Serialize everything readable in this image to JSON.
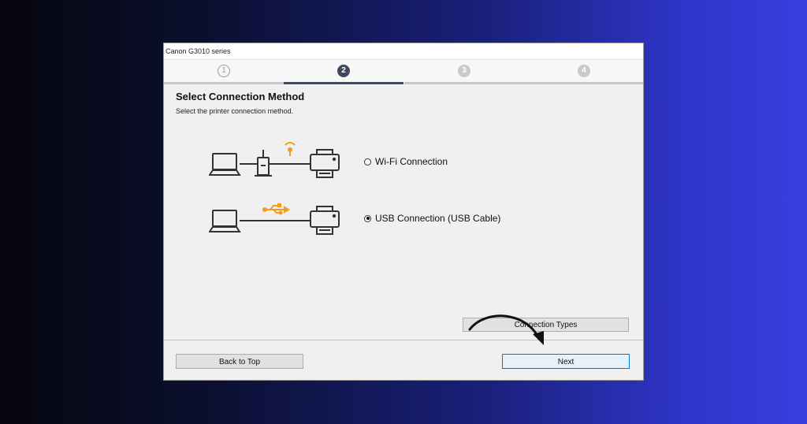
{
  "window": {
    "title": "Canon G3010 series"
  },
  "steps": [
    {
      "label": "1",
      "state": "done"
    },
    {
      "label": "2",
      "state": "active"
    },
    {
      "label": "3",
      "state": "inactive"
    },
    {
      "label": "4",
      "state": "inactive"
    }
  ],
  "main": {
    "heading": "Select Connection Method",
    "subheading": "Select the printer connection method."
  },
  "options": {
    "wifi": {
      "label": "Wi-Fi Connection",
      "selected": false,
      "icon": "wifi-icon"
    },
    "usb": {
      "label": "USB Connection (USB Cable)",
      "selected": true,
      "icon": "usb-icon"
    }
  },
  "buttons": {
    "connection_types": "Connection Types",
    "back_to_top": "Back to Top",
    "next": "Next"
  },
  "colors": {
    "active_step": "#3f4a5e",
    "accent_orange": "#f39c1f",
    "primary_border": "#0078d7"
  }
}
